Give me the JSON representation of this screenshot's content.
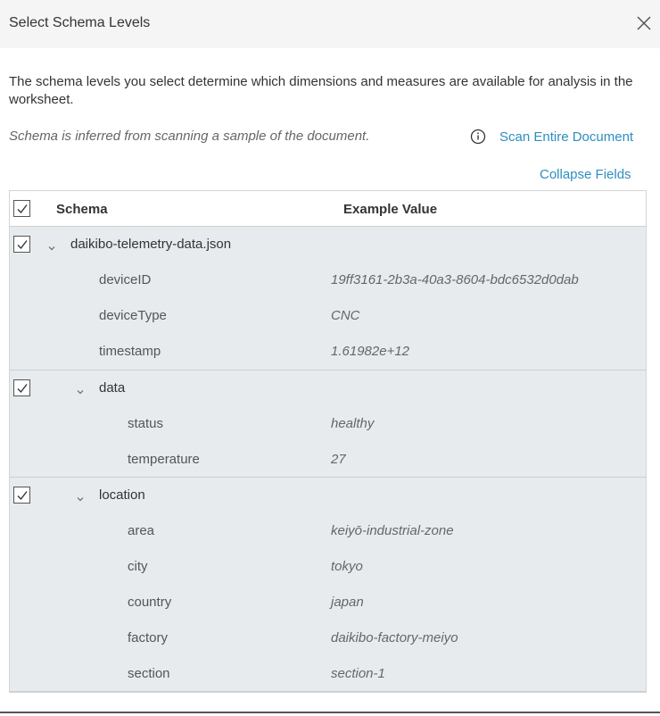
{
  "dialog": {
    "title": "Select Schema Levels",
    "description": "The schema levels you select determine which dimensions and measures are available for analysis in the worksheet.",
    "note": "Schema is inferred from scanning a sample of the document.",
    "scan_label": "Scan Entire Document",
    "collapse_label": "Collapse Fields"
  },
  "table": {
    "headers": {
      "schema": "Schema",
      "example": "Example Value"
    },
    "groups": [
      {
        "name": "daikibo-telemetry-data.json",
        "checked": true,
        "fields": [
          {
            "name": "deviceID",
            "value": "19ff3161-2b3a-40a3-8604-bdc6532d0dab"
          },
          {
            "name": "deviceType",
            "value": "CNC"
          },
          {
            "name": "timestamp",
            "value": "1.61982e+12"
          }
        ]
      },
      {
        "name": "data",
        "checked": true,
        "fields": [
          {
            "name": "status",
            "value": "healthy"
          },
          {
            "name": "temperature",
            "value": "27"
          }
        ]
      },
      {
        "name": "location",
        "checked": true,
        "fields": [
          {
            "name": "area",
            "value": "keiyō-industrial-zone"
          },
          {
            "name": "city",
            "value": "tokyo"
          },
          {
            "name": "country",
            "value": "japan"
          },
          {
            "name": "factory",
            "value": "daikibo-factory-meiyo"
          },
          {
            "name": "section",
            "value": "section-1"
          }
        ]
      }
    ]
  },
  "colors": {
    "link": "#2e8ec0",
    "row_bg": "#e7ebee",
    "header_bg": "#f5f5f5"
  },
  "icons": {
    "close": "close-icon",
    "info": "info-icon",
    "chevron": "chevron-down-icon",
    "check": "checkmark-icon"
  }
}
